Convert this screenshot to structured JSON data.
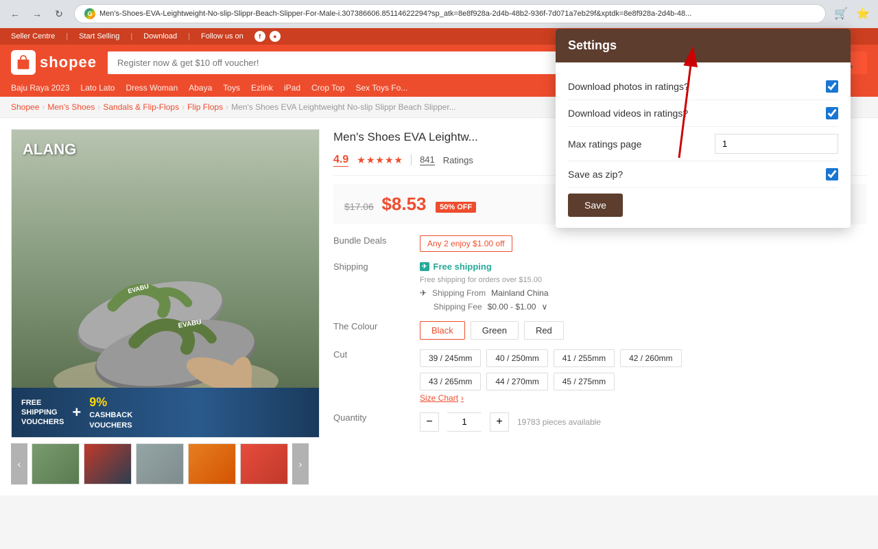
{
  "browser": {
    "url": "Men's-Shoes-EVA-Leightweight-No-slip-Slippr-Beach-Slipper-For-Male-i.307386606.85114622294?sp_atk=8e8f928a-2d4b-48b2-936f-7d071a7eb29f&xptdk=8e8f928a-2d4b-48...",
    "nav": {
      "back": "←",
      "forward": "→",
      "reload": "↻"
    }
  },
  "topbar": {
    "seller_centre": "Seller Centre",
    "start_selling": "Start Selling",
    "download": "Download",
    "follow_us": "Follow us on"
  },
  "header": {
    "logo_text": "shopee",
    "search_placeholder": "Register now & get $10 off voucher!"
  },
  "nav_links": [
    "Baju Raya 2023",
    "Lato Lato",
    "Dress Woman",
    "Abaya",
    "Toys",
    "Ezlink",
    "iPad",
    "Crop Top",
    "Sex Toys Fo..."
  ],
  "breadcrumb": [
    {
      "label": "Shopee",
      "active": true
    },
    {
      "label": "Men's Shoes",
      "active": true
    },
    {
      "label": "Sandals & Flip-Flops",
      "active": true
    },
    {
      "label": "Flip Flops",
      "active": true
    },
    {
      "label": "Men's Shoes EVA Leightweight No-slip Slippr Beach Slipper...",
      "active": false
    }
  ],
  "product": {
    "title": "Men's Shoes EVA Leightw...",
    "rating": "4.9",
    "ratings_count": "841",
    "ratings_label": "Ratings",
    "original_price": "$17.06",
    "sale_price": "$8.53",
    "discount": "50% OFF",
    "bundle_deal": "Any 2 enjoy $1.00 off",
    "shipping_label": "Shipping",
    "free_shipping": "Free shipping",
    "free_shipping_note": "Free shipping for orders over $15.00",
    "shipping_from_label": "Shipping From",
    "shipping_from": "Mainland China",
    "shipping_fee_label": "Shipping Fee",
    "shipping_fee": "$0.00 - $1.00",
    "colour_label": "The Colour",
    "colours": [
      "Black",
      "Green",
      "Red"
    ],
    "cut_label": "Cut",
    "sizes": [
      "39 / 245mm",
      "40 / 250mm",
      "41 / 255mm",
      "42 / 260mm",
      "43 / 265mm",
      "44 / 270mm",
      "45 / 275mm"
    ],
    "size_chart": "Size Chart",
    "quantity_label": "Quantity",
    "quantity": "1",
    "stock": "19783 pieces available",
    "alang_text": "ALANG"
  },
  "settings": {
    "title": "Settings",
    "download_photos_label": "Download photos in ratings?",
    "download_photos_checked": true,
    "download_videos_label": "Download videos in ratings?",
    "download_videos_checked": true,
    "max_ratings_label": "Max ratings page",
    "max_ratings_value": "1",
    "save_as_zip_label": "Save as zip?",
    "save_as_zip_checked": true,
    "save_btn": "Save"
  },
  "thumbs": [
    {
      "id": 1,
      "class": "thumb1"
    },
    {
      "id": 2,
      "class": "thumb2"
    },
    {
      "id": 3,
      "class": "thumb3"
    },
    {
      "id": 4,
      "class": "thumb4"
    },
    {
      "id": 5,
      "class": "thumb5"
    }
  ]
}
